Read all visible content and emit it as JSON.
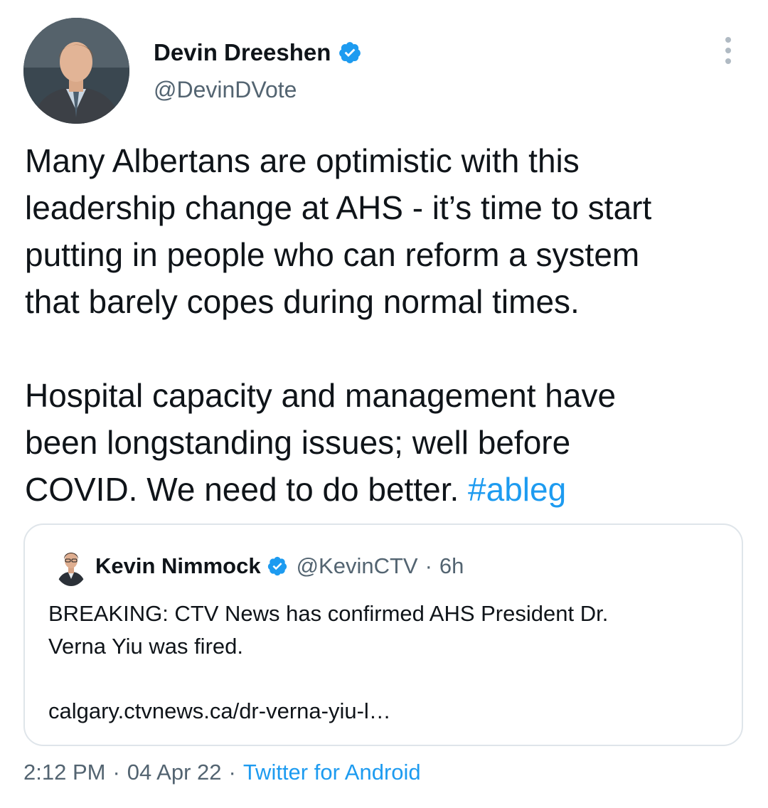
{
  "tweet": {
    "author": {
      "name": "Devin Dreeshen",
      "handle": "@DevinDVote",
      "verified": true
    },
    "text_lines_1": [
      "Many Albertans are optimistic with this",
      "leadership change at AHS - it’s time to start",
      "putting in people who can reform a system",
      "that barely copes during normal times."
    ],
    "text_lines_2": [
      "Hospital capacity and management have",
      "been longstanding issues; well before"
    ],
    "text_line_last": "COVID. We need to do better.",
    "hashtag": "#ableg",
    "time": "2:12 PM",
    "date": "04 Apr 22",
    "source": "Twitter for Android",
    "dot": "·"
  },
  "quoted_tweet": {
    "author": {
      "name": "Kevin Nimmock",
      "handle": "@KevinCTV",
      "verified": true
    },
    "dot": "·",
    "time": "6h",
    "text_lines": [
      "BREAKING: CTV News has confirmed AHS President Dr.",
      "Verna Yiu was fired."
    ],
    "link": "calgary.ctvnews.ca/dr-verna-yiu-l…"
  },
  "icons": {
    "verified": "verified-badge-icon",
    "more": "more-vertical-icon"
  },
  "colors": {
    "accent": "#1d9bf0",
    "text": "#0f1419",
    "secondary": "#536471",
    "border": "#dfe5ea"
  }
}
